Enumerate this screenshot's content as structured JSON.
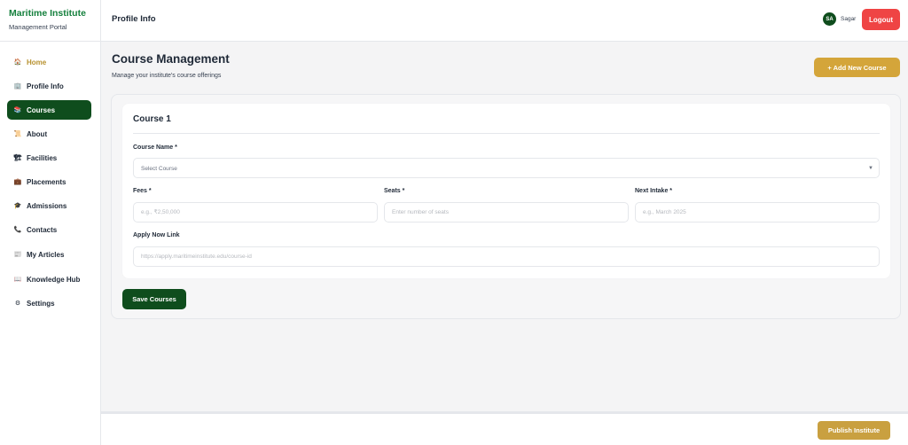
{
  "sidebar": {
    "brand_title": "Maritime Institute",
    "brand_subtitle": "Management Portal",
    "items": [
      {
        "label": "Home",
        "icon": "home-icon",
        "glyph": "🏠"
      },
      {
        "label": "Profile Info",
        "icon": "building-icon",
        "glyph": "🏢"
      },
      {
        "label": "Courses",
        "icon": "books-icon",
        "glyph": "📚"
      },
      {
        "label": "About",
        "icon": "scroll-icon",
        "glyph": "📜"
      },
      {
        "label": "Facilities",
        "icon": "construction-icon",
        "glyph": "🏗"
      },
      {
        "label": "Placements",
        "icon": "briefcase-icon",
        "glyph": "💼"
      },
      {
        "label": "Admissions",
        "icon": "graduation-cap-icon",
        "glyph": "🎓"
      },
      {
        "label": "Contacts",
        "icon": "phone-icon",
        "glyph": "📞"
      },
      {
        "label": "My Articles",
        "icon": "document-icon",
        "glyph": "📰"
      },
      {
        "label": "Knowledge Hub",
        "icon": "book-icon",
        "glyph": "📖"
      },
      {
        "label": "Settings",
        "icon": "gear-icon",
        "glyph": "⚙"
      }
    ],
    "active_item": "Courses"
  },
  "header": {
    "title": "Profile Info",
    "avatar_initials": "SA",
    "username": "Sagar",
    "logout_label": "Logout"
  },
  "main": {
    "title": "Course Management",
    "subtitle": "Manage your institute's course offerings",
    "add_button_label": "+ Add New Course",
    "course": {
      "title": "Course 1",
      "course_name_label": "Course Name *",
      "course_name_value": "Select Course",
      "fees_label": "Fees *",
      "fees_placeholder": "e.g., ₹2,50,000",
      "seats_label": "Seats *",
      "seats_placeholder": "Enter number of seats",
      "intake_label": "Next Intake *",
      "intake_placeholder": "e.g., March 2025",
      "link_label": "Apply Now Link",
      "link_placeholder": "https://apply.maritimeinstitute.edu/course-id"
    },
    "save_button_label": "Save Courses"
  },
  "footer": {
    "publish_label": "Publish Institute"
  },
  "colors": {
    "brand_green": "#15803d",
    "active_nav": "#0f4d1d",
    "gold": "#d4a53a",
    "logout_red": "#ef4444"
  }
}
